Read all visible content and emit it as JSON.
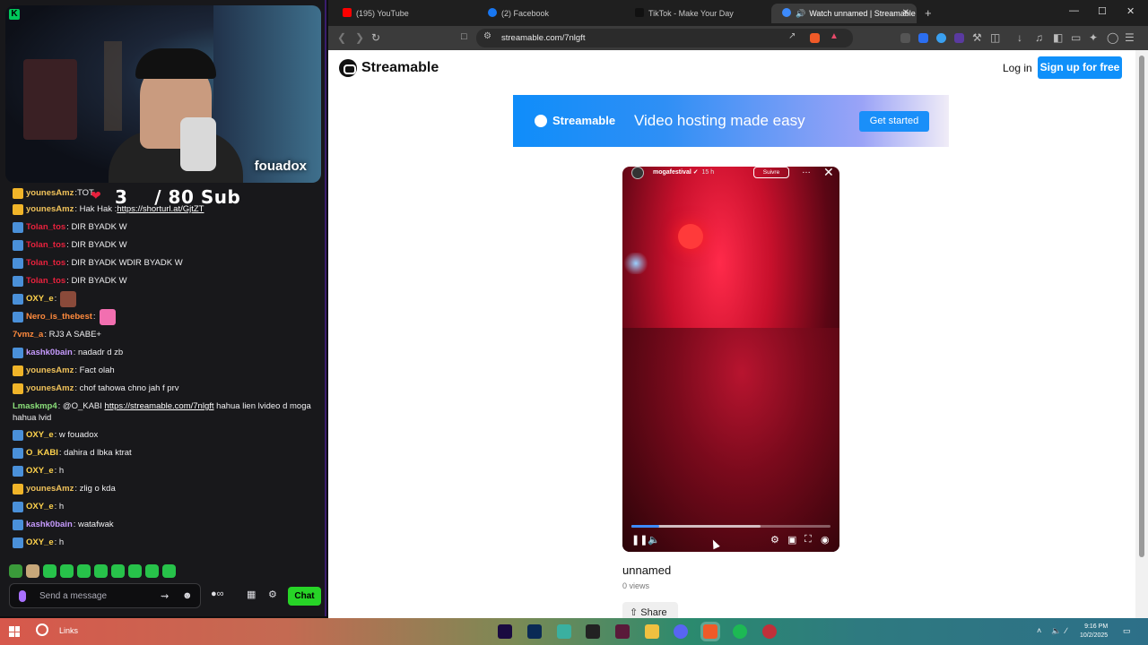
{
  "stream": {
    "streamer_name": "fouadox",
    "sub_goal_current": "3",
    "sub_goal_text": "/ 80 Sub",
    "partial_message": "TOT"
  },
  "chat": {
    "messages": [
      {
        "badge": "crown",
        "user": "younesAmz",
        "color": "#f0c25a",
        "text": ": Hak Hak : ",
        "link": "https://shorturl.at/GjtZT"
      },
      {
        "badge": "prime",
        "user": "Tolan_tos",
        "color": "#e8213d",
        "text": ": DIR BYADK W"
      },
      {
        "badge": "prime",
        "user": "Tolan_tos",
        "color": "#e8213d",
        "text": ": DIR BYADK W"
      },
      {
        "badge": "prime",
        "user": "Tolan_tos",
        "color": "#e8213d",
        "text": ": DIR BYADK WDIR BYADK W"
      },
      {
        "badge": "prime",
        "user": "Tolan_tos",
        "color": "#e8213d",
        "text": ": DIR BYADK W"
      },
      {
        "badge": "prime",
        "user": "OXY_e",
        "color": "#ffd34d",
        "text": ":",
        "emote": "#8a4a3a"
      },
      {
        "badge": "prime",
        "user": "Nero_is_thebest",
        "color": "#ff8a3d",
        "text": ":",
        "emote": "#f26fb0"
      },
      {
        "badge": "",
        "user": "7vmz_a",
        "color": "#ff8a3d",
        "text": ": RJ3 A SABE+"
      },
      {
        "badge": "prime",
        "user": "kashk0bain",
        "color": "#c79bff",
        "text": ": nadadr d zb"
      },
      {
        "badge": "crown",
        "user": "younesAmz",
        "color": "#f0c25a",
        "text": ": Fact olah"
      },
      {
        "badge": "crown",
        "user": "younesAmz",
        "color": "#f0c25a",
        "text": ": chof tahowa chno jah f prv"
      }
    ],
    "wrapped_message": {
      "user": "Lmaskmp4",
      "color": "#8be07a",
      "text_before": ": @O_KABI ",
      "link": "https://streamable.com/7nlgft",
      "text_after": " hahua lien lvideo d moga hahua lvid"
    },
    "messages_after": [
      {
        "badge": "prime",
        "user": "OXY_e",
        "color": "#ffd34d",
        "text": ": w fouadox"
      },
      {
        "badge": "prime",
        "user": "O_KABI",
        "color": "#ffd34d",
        "text": ": dahira d lbka ktrat"
      },
      {
        "badge": "prime",
        "user": "OXY_e",
        "color": "#ffd34d",
        "text": ": h"
      },
      {
        "badge": "crown",
        "user": "younesAmz",
        "color": "#f0c25a",
        "text": ": zlig o kda"
      },
      {
        "badge": "prime",
        "user": "OXY_e",
        "color": "#ffd34d",
        "text": ": h"
      },
      {
        "badge": "prime",
        "user": "kashk0bain",
        "color": "#c79bff",
        "text": ": watafwak"
      },
      {
        "badge": "prime",
        "user": "OXY_e",
        "color": "#ffd34d",
        "text": ": h"
      }
    ],
    "input_placeholder": "Send a message",
    "chat_button": "Chat"
  },
  "browser": {
    "tabs": [
      {
        "label": "(195) YouTube",
        "favicon_color": "#ff0000"
      },
      {
        "label": "(2) Facebook",
        "favicon_color": "#1877f2"
      },
      {
        "label": "TikTok - Make Your Day",
        "favicon_color": "#000000"
      },
      {
        "label": "Watch unnamed | Streamable",
        "favicon_color": "#3d8bfd",
        "active": true
      }
    ],
    "url": "streamable.com/7nlgft"
  },
  "page": {
    "logo_text": "Streamable",
    "login_label": "Log in",
    "signup_label": "Sign up for free",
    "banner": {
      "brand": "Streamable",
      "tagline": "Video hosting made easy",
      "cta": "Get started"
    },
    "video": {
      "account": "mogafestival",
      "follow_label": "Suivre",
      "time_ago": "15 h",
      "progress_played": 0.14,
      "progress_buffered": 0.65
    },
    "title": "unnamed",
    "views": "0 views",
    "share_label": "Share"
  },
  "taskbar": {
    "search_label": "Links",
    "time": "9:16 PM",
    "date": "10/2/2025"
  }
}
